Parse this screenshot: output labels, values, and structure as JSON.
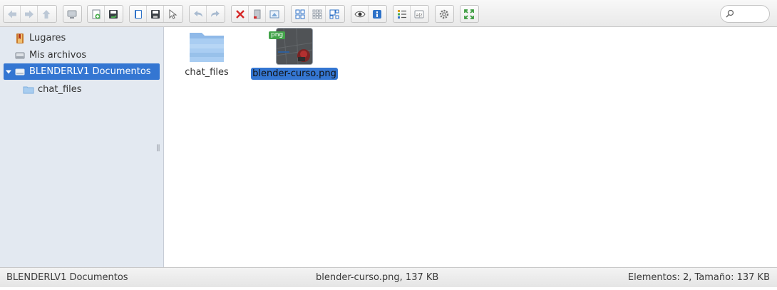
{
  "toolbar": {
    "buttons": [
      {
        "name": "back-button",
        "icon": "arrow-left-icon"
      },
      {
        "name": "forward-button",
        "icon": "arrow-right-icon"
      },
      {
        "name": "up-button",
        "icon": "arrow-up-icon"
      },
      {
        "name": "computer-button",
        "icon": "computer-icon"
      },
      {
        "name": "new-folder-button",
        "icon": "new-folder-icon"
      },
      {
        "name": "save-button",
        "icon": "save-green-icon"
      },
      {
        "name": "open-button",
        "icon": "open-book-icon"
      },
      {
        "name": "save-as-button",
        "icon": "floppy-icon"
      },
      {
        "name": "select-button",
        "icon": "cursor-icon"
      },
      {
        "name": "undo-button",
        "icon": "undo-icon"
      },
      {
        "name": "redo-button",
        "icon": "redo-icon"
      },
      {
        "name": "delete-button",
        "icon": "delete-x-icon"
      },
      {
        "name": "copy-button",
        "icon": "copy-icon"
      },
      {
        "name": "image-button",
        "icon": "image-icon"
      },
      {
        "name": "view-grid-button",
        "icon": "grid-large-icon"
      },
      {
        "name": "view-small-grid-button",
        "icon": "grid-small-icon"
      },
      {
        "name": "view-thumbnails-button",
        "icon": "thumbnails-icon"
      },
      {
        "name": "preview-button",
        "icon": "eye-icon"
      },
      {
        "name": "info-button",
        "icon": "info-icon"
      },
      {
        "name": "details-view-button",
        "icon": "list-details-icon"
      },
      {
        "name": "sort-button",
        "icon": "sort-az-icon"
      },
      {
        "name": "settings-button",
        "icon": "gear-icon"
      },
      {
        "name": "fullscreen-button",
        "icon": "expand-icon"
      }
    ],
    "search_placeholder": ""
  },
  "sidebar": {
    "items": [
      {
        "label": "Lugares",
        "icon": "bookmark-icon"
      },
      {
        "label": "Mis archivos",
        "icon": "drive-icon"
      },
      {
        "label": "BLENDERLV1 Documentos",
        "icon": "drive-icon",
        "expanded": true,
        "active": true
      },
      {
        "label": "chat_files",
        "icon": "folder-icon"
      }
    ]
  },
  "files": [
    {
      "name": "chat_files",
      "type": "folder"
    },
    {
      "name": "blender-curso.png",
      "type": "image",
      "badge": "png",
      "selected": true
    }
  ],
  "status": {
    "left": "BLENDERLV1 Documentos",
    "center": "blender-curso.png, 137 KB",
    "right": "Elementos: 2, Tamaño: 137 KB"
  },
  "colors": {
    "selection": "#3476d2",
    "sidebar_bg": "#e3e9f1",
    "badge": "#43a44a"
  }
}
